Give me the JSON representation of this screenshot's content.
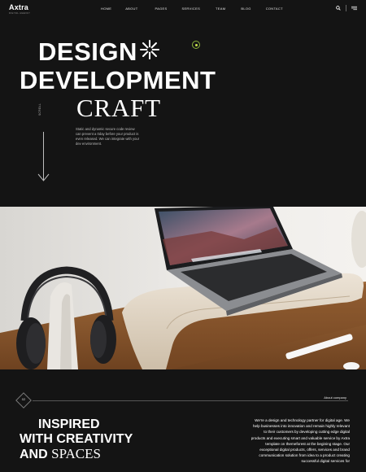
{
  "brand": {
    "name": "Axtra",
    "tagline": "DIGITAL AGENCY"
  },
  "nav": {
    "items": [
      "HOME",
      "ABOUT",
      "PAGES",
      "SERVICES",
      "TEAM",
      "BLOG",
      "CONTACT"
    ],
    "icons": [
      "search-icon",
      "menu-icon"
    ]
  },
  "hero": {
    "line1": "DESIGN",
    "line2": "DEVELOPMENT",
    "line3": "CRAFT",
    "scroll_label": "SCROLL",
    "intro": "Static and dynamic secure code review can prevent a 0day before your product is even released. We can integrate with your dev environment."
  },
  "about": {
    "number": "02",
    "label": "About company",
    "headline_1": "INSPIRED",
    "headline_2": "WITH CREATIVITY",
    "headline_3a": "AND",
    "headline_3b": "SPACES",
    "text_lead": "We're a design and technology partner for",
    "text_bold": "digital age. We help businesses into innovation and remain highly relevant to their customers by developing cutting edge digital products and executing smart and valuable service by Axtra template on themeforest at the begining stage.",
    "text_tail": "Our exceptional digital products, offers, services and brand communication solution from idea to a product creating successful digital services for"
  },
  "colors": {
    "background": "#141414",
    "accent": "#c6e34b"
  }
}
